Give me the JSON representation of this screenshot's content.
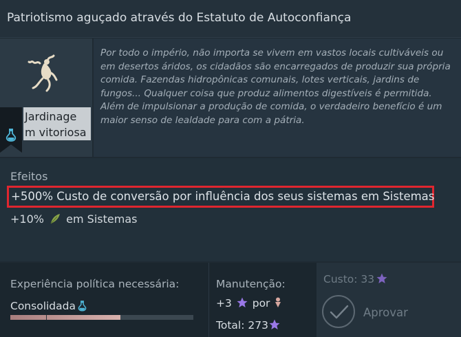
{
  "header": {
    "title": "Patriotismo aguçado através do Estatuto de Autoconfiança"
  },
  "card": {
    "icon": "sprout-figure-icon",
    "ribbon_icon": "potion-flask-icon",
    "name_line1": "Jardinage",
    "name_line2": "m vitoriosa"
  },
  "description": "Por todo o império, não importa se vivem em vastos locais cultiváveis ou em desertos áridos, os cidadãos são encarregados de produzir sua própria comida. Fazendas hidropônicas comunais, lotes verticais, jardins de fungos... Qualquer coisa que produz alimentos digestíveis é permitida. Além de impulsionar a produção de comida, o verdadeiro benefício é um maior senso de lealdade para com a pátria.",
  "effects": {
    "label": "Efeitos",
    "effect1": "+500% Custo de conversão por influência dos seus sistemas em Sistemas",
    "effect2_value": "+10%",
    "effect2_icon": "food-leaf-icon",
    "effect2_suffix": "em Sistemas"
  },
  "experience": {
    "label": "Experiência política necessária:",
    "value": "Consolidada",
    "value_icon": "potion-flask-icon",
    "progress": 0.6
  },
  "maintenance": {
    "label": "Manutenção:",
    "amount": "+3",
    "amount_icon": "influence-star-icon",
    "per": "por",
    "per_icon": "population-icon",
    "total_label": "Total: 273",
    "total_icon": "influence-star-icon"
  },
  "cost": {
    "label": "Custo: 33",
    "icon": "influence-star-icon",
    "approve_label": "Aprovar"
  },
  "colors": {
    "highlight_border": "#e0262f",
    "influence_star": "#9a78e8",
    "food_leaf": "#8aa64a",
    "flask": "#4fb6d8",
    "progress_fill": "#d8b1ad"
  }
}
